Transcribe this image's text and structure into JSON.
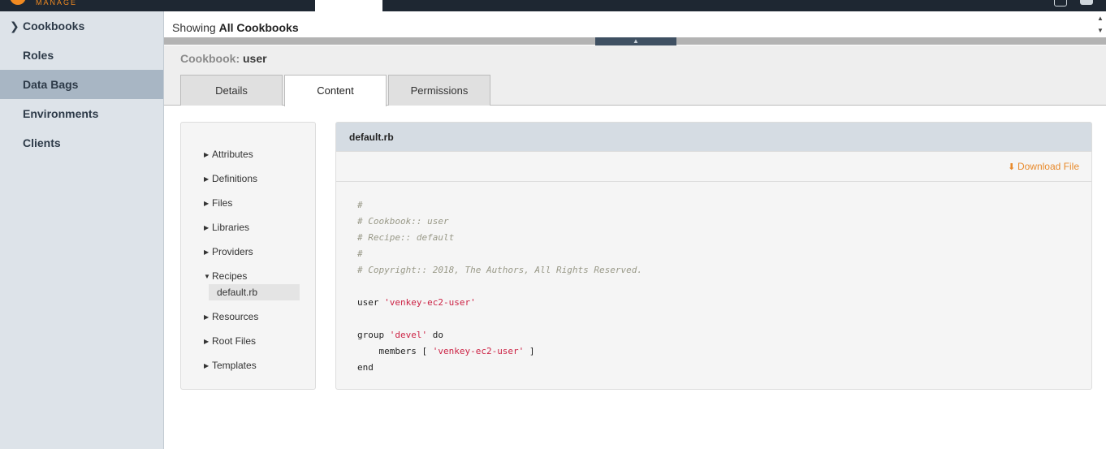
{
  "app": {
    "logo_text": "MANAGE"
  },
  "sidebar": {
    "items": [
      {
        "label": "Cookbooks",
        "expanded": true
      },
      {
        "label": "Roles"
      },
      {
        "label": "Data Bags",
        "active": true
      },
      {
        "label": "Environments"
      },
      {
        "label": "Clients"
      }
    ]
  },
  "showing": {
    "prefix": "Showing",
    "value": "All Cookbooks"
  },
  "cookbook": {
    "label": "Cookbook:",
    "name": "user"
  },
  "tabs": [
    {
      "label": "Details"
    },
    {
      "label": "Content",
      "active": true
    },
    {
      "label": "Permissions"
    }
  ],
  "tree": {
    "items": [
      {
        "label": "Attributes"
      },
      {
        "label": "Definitions"
      },
      {
        "label": "Files"
      },
      {
        "label": "Libraries"
      },
      {
        "label": "Providers"
      },
      {
        "label": "Recipes",
        "expanded": true
      },
      {
        "label": "Resources"
      },
      {
        "label": "Root Files"
      },
      {
        "label": "Templates"
      }
    ],
    "selected_file": "default.rb"
  },
  "file": {
    "name": "default.rb",
    "download_label": "Download File",
    "code": [
      "#",
      "# Cookbook:: user",
      "# Recipe:: default",
      "#",
      "# Copyright:: 2018, The Authors, All Rights Reserved.",
      "",
      "user 'venkey-ec2-user'",
      "",
      "group 'devel' do",
      "    members [ 'venkey-ec2-user' ]",
      "end"
    ]
  },
  "colors": {
    "accent": "#e88a2c",
    "sidebar_bg": "#dde3e9",
    "sidebar_active": "#a8b6c4",
    "topnav": "#1e2732"
  }
}
